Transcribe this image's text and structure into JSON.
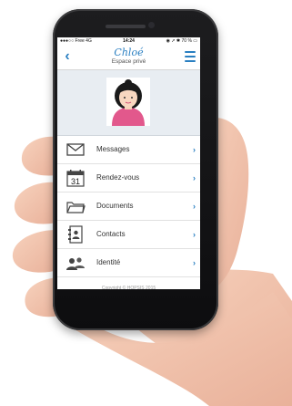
{
  "status_bar": {
    "carrier": "●●●○○ Free  4G",
    "time": "14:24",
    "right": "◉ ➚ ✱ 70 % ▭"
  },
  "nav": {
    "title": "Chloé",
    "subtitle": "Espace privé"
  },
  "menu": {
    "items": [
      {
        "label": "Messages"
      },
      {
        "label": "Rendez-vous"
      },
      {
        "label": "Documents"
      },
      {
        "label": "Contacts"
      },
      {
        "label": "Identité"
      }
    ]
  },
  "calendar_icon_day": "31",
  "footer": {
    "copyright": "Copyright © HOPSIS 2015"
  },
  "colors": {
    "accent": "#2a7fc1",
    "avatar_bg": "#e8edf2",
    "avatar_shirt": "#e2588c"
  }
}
